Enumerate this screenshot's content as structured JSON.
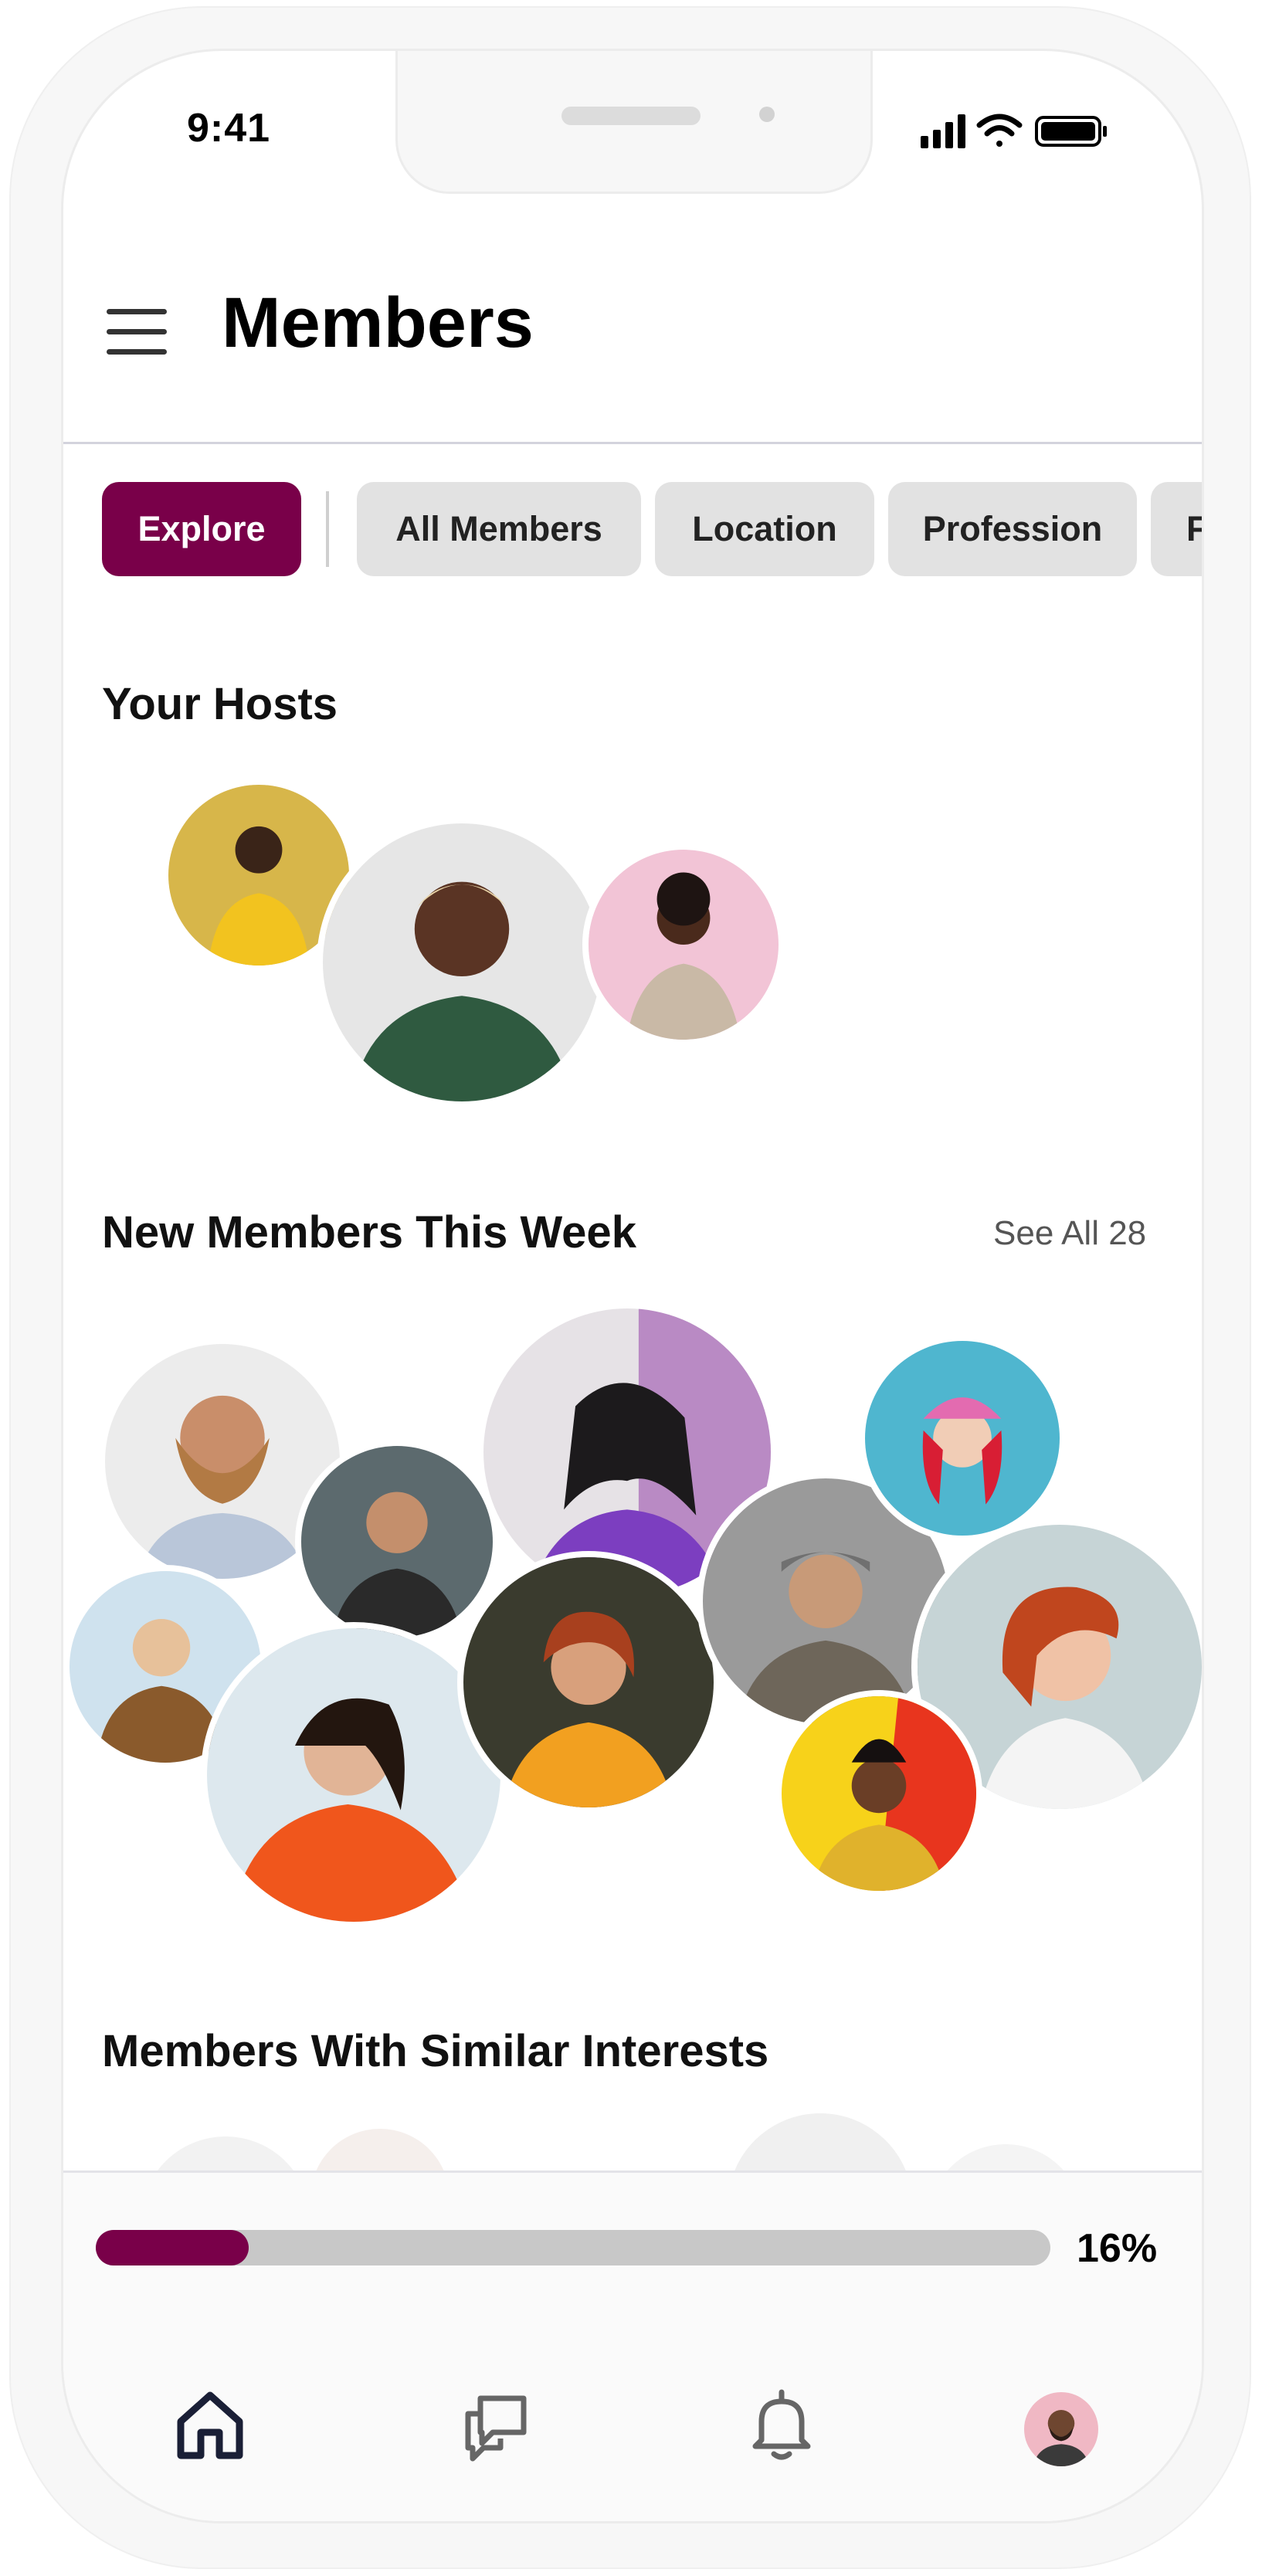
{
  "status_bar": {
    "time": "9:41",
    "icons": [
      "signal-icon",
      "wifi-icon",
      "battery-icon"
    ]
  },
  "header": {
    "title": "Members",
    "menu_icon": "hamburger-icon"
  },
  "filters": [
    {
      "label": "Explore",
      "active": true
    },
    {
      "label": "All Members",
      "active": false
    },
    {
      "label": "Location",
      "active": false
    },
    {
      "label": "Profession",
      "active": false
    },
    {
      "label": "F",
      "active": false
    }
  ],
  "hosts": {
    "title": "Your Hosts"
  },
  "new_members": {
    "title": "New Members This Week",
    "see_all": "See All 28"
  },
  "similar": {
    "title": "Members With Similar Interests"
  },
  "progress": {
    "value": 0.16,
    "label": "16%"
  },
  "tab_bar": [
    {
      "icon": "home-icon",
      "active": true
    },
    {
      "icon": "chat-icon",
      "active": false
    },
    {
      "icon": "bell-icon",
      "active": false
    },
    {
      "icon": "profile-avatar",
      "active": false
    }
  ],
  "colors": {
    "accent": "#790049",
    "chip_bg": "#e2e2e2",
    "track": "#c8c8c8"
  }
}
